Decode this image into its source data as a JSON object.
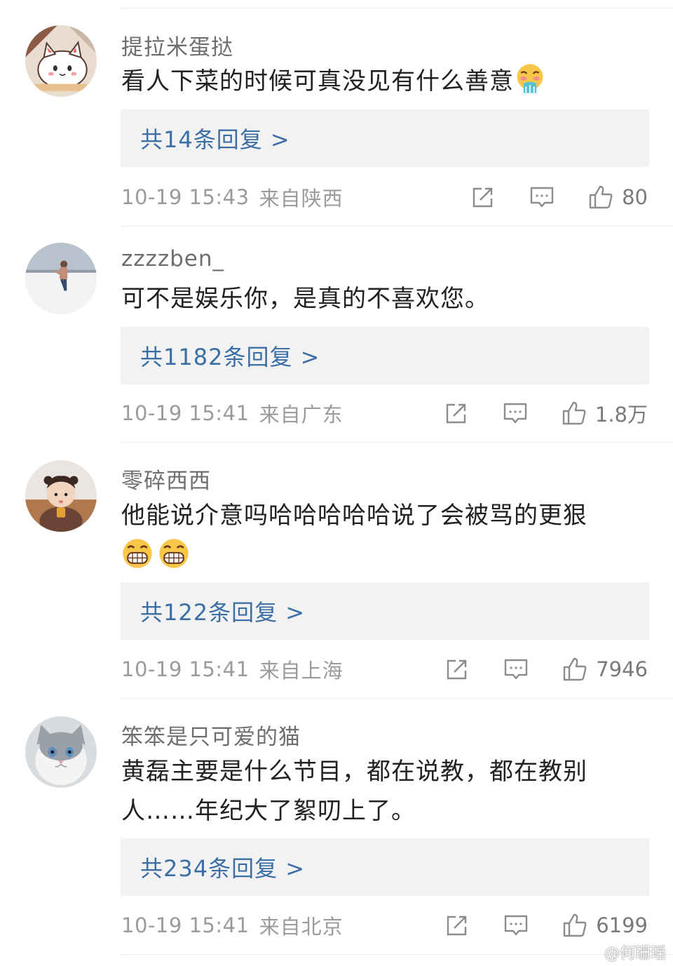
{
  "comments": [
    {
      "username": "提拉米蛋挞",
      "text": "看人下菜的时候可真没见有什么善意",
      "emojis": [
        "vomit-face-icon"
      ],
      "replies": "共14条回复 >",
      "time": "10-19 15:43",
      "source": "来自陕西",
      "likes": "80"
    },
    {
      "username": "zzzzben_",
      "text": "可不是娱乐你，是真的不喜欢您。",
      "emojis": [],
      "replies": "共1182条回复 >",
      "time": "10-19 15:41",
      "source": "来自广东",
      "likes": "1.8万"
    },
    {
      "username": "零碎西西",
      "text": "他能说介意吗哈哈哈哈哈说了会被骂的更狠",
      "emojis": [
        "grin-face-icon",
        "grin-face-icon"
      ],
      "replies": "共122条回复 >",
      "time": "10-19 15:41",
      "source": "来自上海",
      "likes": "7946"
    },
    {
      "username": "笨笨是只可爱的猫",
      "text": "黄磊主要是什么节目，都在说教，都在教别人……年纪大了絮叨上了。",
      "emojis": [],
      "replies": "共234条回复 >",
      "time": "10-19 15:41",
      "source": "来自北京",
      "likes": "6199"
    }
  ],
  "watermark": "@何珊瑶",
  "colors": {
    "link": "#3c6fa6",
    "meta": "#9b9b9b",
    "reply_bg": "#f2f2f2"
  }
}
